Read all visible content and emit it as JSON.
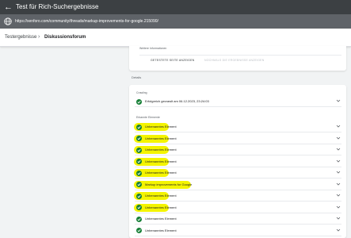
{
  "window": {
    "title": "Test für Rich-Suchergebnisse",
    "back_icon": "arrow-back-icon"
  },
  "browser": {
    "url": "https://xenforo.com/community/threads/markup-improvements-for-google.215090/",
    "globe_icon": "globe-icon"
  },
  "breadcrumb": {
    "items": [
      "Testergebnisse",
      "Diskussionsforum"
    ],
    "separator": "›"
  },
  "top_card": {
    "more_info": "Weitere Informationen",
    "buttons": [
      "GETESTETE SEITE ANZEIGEN",
      "NOCHMALS DIE ERGEBNISSE ANZEIGEN"
    ]
  },
  "details": {
    "label": "Details",
    "crawling": {
      "heading": "Crawling",
      "status": "Erfolgreich gecrawlt am 06.12.2023, 23:24:03"
    },
    "elements": {
      "heading": "Erkannte Elemente",
      "items": [
        {
          "label": "Unbenanntes Element",
          "highlighted": true
        },
        {
          "label": "Unbenanntes Element",
          "highlighted": true
        },
        {
          "label": "Unbenanntes Element",
          "highlighted": true
        },
        {
          "label": "Unbenanntes Element",
          "highlighted": true
        },
        {
          "label": "Unbenanntes Element",
          "highlighted": true
        },
        {
          "label": "Markup improvements for Google",
          "highlighted": true
        },
        {
          "label": "Unbenanntes Element",
          "highlighted": true
        },
        {
          "label": "Unbenanntes Element",
          "highlighted": true
        },
        {
          "label": "Unbenanntes Element",
          "highlighted": false
        },
        {
          "label": "Unbenanntes Element",
          "highlighted": false
        }
      ]
    }
  },
  "colors": {
    "success": "#188038",
    "highlight": "#f4f400",
    "header": "#3c4043"
  }
}
